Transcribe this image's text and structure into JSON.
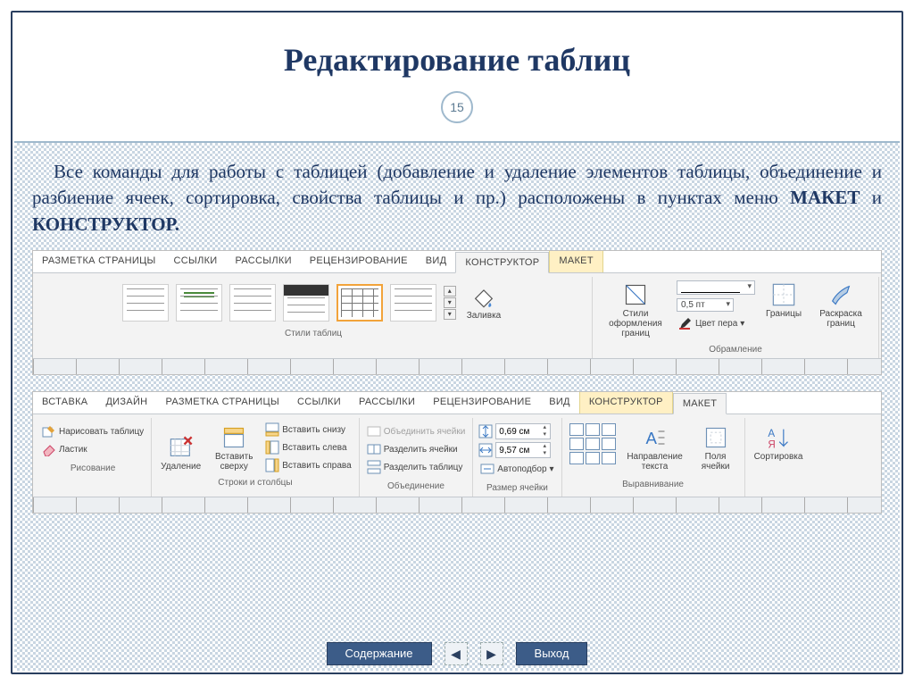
{
  "title": "Редактирование таблиц",
  "page_number": "15",
  "paragraph_prefix": "Все команды для работы с таблицей (добавление и удаление элементов таблицы, объединение и разбиение ячеек,  сортировка,  свойства таблицы и пр.) расположены в пунктах меню ",
  "paragraph_bold1": "МАКЕТ",
  "paragraph_mid": " и ",
  "paragraph_bold2": "КОНСТРУКТОР.",
  "ribbon1": {
    "tabs": [
      "РАЗМЕТКА СТРАНИЦЫ",
      "ССЫЛКИ",
      "РАССЫЛКИ",
      "РЕЦЕНЗИРОВАНИЕ",
      "ВИД",
      "КОНСТРУКТОР",
      "МАКЕТ"
    ],
    "active_tab": "КОНСТРУКТОР",
    "groups": {
      "styles_label": "Стили таблиц",
      "fill": "Заливка",
      "border_styles": "Стили оформления границ",
      "width": "0,5 пт",
      "pen_color": "Цвет пера",
      "borders": "Границы",
      "border_painter": "Раскраска границ",
      "framing_label": "Обрамление"
    }
  },
  "ribbon2": {
    "tabs": [
      "ВСТАВКА",
      "ДИЗАЙН",
      "РАЗМЕТКА СТРАНИЦЫ",
      "ССЫЛКИ",
      "РАССЫЛКИ",
      "РЕЦЕНЗИРОВАНИЕ",
      "ВИД",
      "КОНСТРУКТОР",
      "МАКЕТ"
    ],
    "active_tab": "МАКЕТ",
    "draw": {
      "draw_table": "Нарисовать таблицу",
      "eraser": "Ластик",
      "group_label": "Рисование"
    },
    "rows_cols": {
      "delete": "Удаление",
      "insert_above": "Вставить сверху",
      "insert_below": "Вставить снизу",
      "insert_left": "Вставить слева",
      "insert_right": "Вставить справа",
      "group_label": "Строки и столбцы"
    },
    "merge": {
      "merge_cells": "Объединить ячейки",
      "split_cells": "Разделить ячейки",
      "split_table": "Разделить таблицу",
      "group_label": "Объединение"
    },
    "cell_size": {
      "height": "0,69 см",
      "width": "9,57 см",
      "autofit": "Автоподбор",
      "group_label": "Размер ячейки"
    },
    "alignment": {
      "text_direction": "Направление текста",
      "cell_margins": "Поля ячейки",
      "group_label": "Выравнивание"
    },
    "data": {
      "sort": "Сортировка"
    }
  },
  "footer": {
    "contents": "Содержание",
    "exit": "Выход"
  }
}
